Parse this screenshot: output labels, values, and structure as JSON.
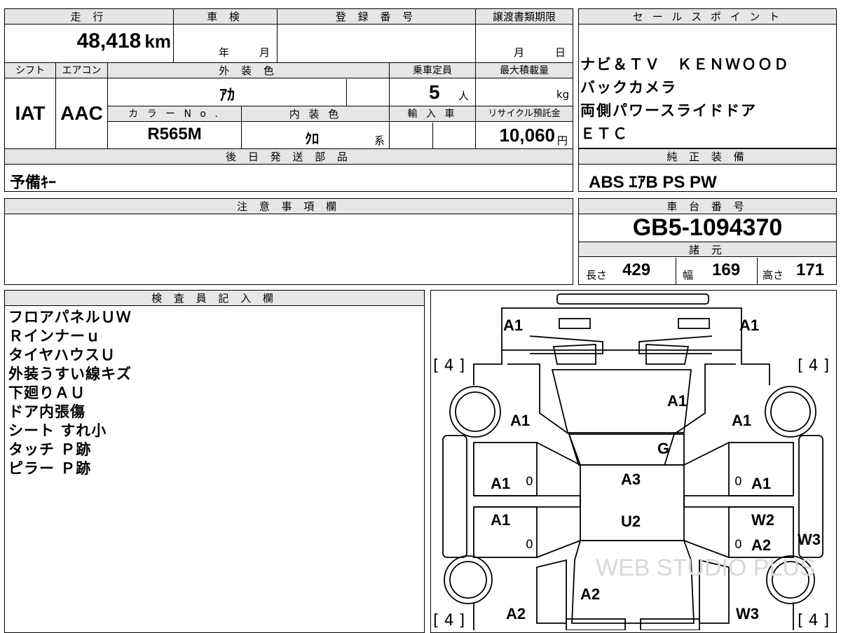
{
  "top": {
    "mileage_header": "走 行",
    "mileage_value": "48,418",
    "mileage_unit": "km",
    "inspection_header": "車 検",
    "inspection_year": "年",
    "inspection_month": "月",
    "registration_header": "登 録 番 号",
    "transfer_header": "譲渡書類期限",
    "transfer_month": "月",
    "transfer_day": "日"
  },
  "row2": {
    "shift_header": "シフト",
    "shift_value": "IAT",
    "ac_header": "エアコン",
    "ac_value": "AAC",
    "exterior_header": "外 装 色",
    "exterior_value": "ｱｶ",
    "capacity_header": "乗車定員",
    "capacity_value": "5",
    "capacity_unit": "人",
    "maxload_header": "最大積載量",
    "maxload_unit": "kg",
    "colorno_header": "カ ラ ー N o .",
    "colorno_value": "R565M",
    "interior_header": "内 装 色",
    "interior_value": "ｸﾛ",
    "interior_suffix": "系",
    "import_header": "輸 入 車",
    "recycle_header": "リサイクル預託金",
    "recycle_value": "10,060",
    "recycle_unit": "円"
  },
  "later_parts": {
    "header": "後 日 発 送 部 品",
    "value": "予備ｷｰ"
  },
  "sales_points": {
    "header": "セ ー ル ス ポ イ ン ト",
    "lines": [
      "ナビ＆ＴＶ　ＫＥＮＷＯＯＤ",
      "バックカメラ",
      "両側パワースライドドア",
      "ＥＴＣ"
    ]
  },
  "standard_equipment": {
    "header": "純 正 装 備",
    "value": "ABS ｴｱB PS PW"
  },
  "caution": {
    "header": "注 意 事 項 欄"
  },
  "chassis": {
    "header": "車 台 番 号",
    "value": "GB5-1094370"
  },
  "specs": {
    "header": "諸 元",
    "length_label": "長さ",
    "length_value": "429",
    "width_label": "幅",
    "width_value": "169",
    "height_label": "高さ",
    "height_value": "171"
  },
  "inspector": {
    "header": "検 査 員 記 入 欄",
    "lines": [
      "フロアパネルＵＷ",
      "Ｒインナーｕ",
      "タイヤハウスＵ",
      "外装うすい線キズ",
      "下廻りＡＵ",
      "ドア内張傷",
      "シート すれ小",
      "タッチ Ｐ跡",
      "ピラー Ｐ跡"
    ]
  },
  "diagram": {
    "tire_tl": "[ 4 ]",
    "tire_tr": "[ 4 ]",
    "tire_bl": "[ 4 ]",
    "tire_br": "[ 4 ]",
    "marks": {
      "front_left_corner": "A1",
      "front_right_corner": "A1",
      "hood": "A1",
      "front_left_fender": "A1",
      "front_right_fender": "A1",
      "windshield": "G",
      "roof_front": "A3",
      "roof_rear": "U2",
      "front_left_door": "A1",
      "rear_left_door": "A1",
      "front_right_door": "A1",
      "rear_right_door_a": "W2",
      "rear_right_door_b": "A2",
      "right_step": "W3",
      "rear_glass": "A2",
      "rear_left_quarter": "A2",
      "rear_right_quarter": "W3",
      "zero_mark": "0"
    },
    "watermark": "WEB STUDIO PLUS"
  }
}
